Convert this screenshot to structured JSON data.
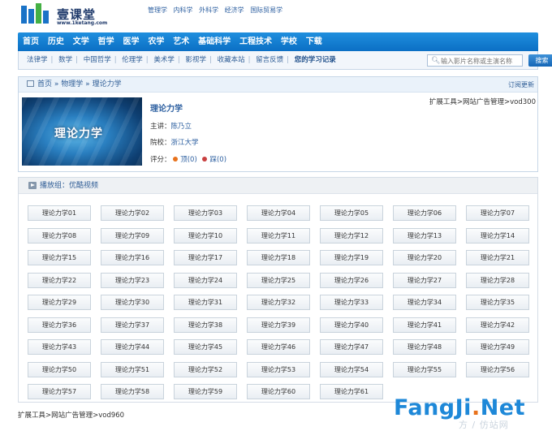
{
  "logo": {
    "name": "壹课堂",
    "url": "www.1ketang.com"
  },
  "toplinks": [
    "管理学",
    "内科学",
    "外科学",
    "经济学",
    "国际贸易学"
  ],
  "nav": [
    "首页",
    "历史",
    "文学",
    "哲学",
    "医学",
    "农学",
    "艺术",
    "基础科学",
    "工程技术",
    "学校",
    "下载"
  ],
  "subnav": [
    "法律学",
    "数学",
    "中国哲学",
    "伦理学",
    "美术学",
    "影视学",
    "收藏本站",
    "留言反馈",
    "您的学习记录"
  ],
  "search": {
    "placeholder": "输入影片名称或主演名称",
    "button": "搜索"
  },
  "breadcrumb": {
    "home": "首页",
    "sep1": "»",
    "category": "物理学",
    "sep2": "»",
    "current": "理论力学",
    "subscribe": "订阅更新"
  },
  "course": {
    "thumb_text": "理论力学",
    "title": "理论力学",
    "lecturer_label": "主讲：",
    "lecturer": "陈乃立",
    "school_label": "院校：",
    "school": "浙江大学",
    "rating_label": "评分：",
    "up": "顶(0)",
    "down": "踩(0)"
  },
  "ad_top": "扩展工具>网站广告管理>vod300",
  "playlist": {
    "label": "播放组：优酷视频",
    "episodes": [
      "理论力学01",
      "理论力学02",
      "理论力学03",
      "理论力学04",
      "理论力学05",
      "理论力学06",
      "理论力学07",
      "理论力学08",
      "理论力学09",
      "理论力学10",
      "理论力学11",
      "理论力学12",
      "理论力学13",
      "理论力学14",
      "理论力学15",
      "理论力学16",
      "理论力学17",
      "理论力学18",
      "理论力学19",
      "理论力学20",
      "理论力学21",
      "理论力学22",
      "理论力学23",
      "理论力学24",
      "理论力学25",
      "理论力学26",
      "理论力学27",
      "理论力学28",
      "理论力学29",
      "理论力学30",
      "理论力学31",
      "理论力学32",
      "理论力学33",
      "理论力学34",
      "理论力学35",
      "理论力学36",
      "理论力学37",
      "理论力学38",
      "理论力学39",
      "理论力学40",
      "理论力学41",
      "理论力学42",
      "理论力学43",
      "理论力学44",
      "理论力学45",
      "理论力学46",
      "理论力学47",
      "理论力学48",
      "理论力学49",
      "理论力学50",
      "理论力学51",
      "理论力学52",
      "理论力学53",
      "理论力学54",
      "理论力学55",
      "理论力学56",
      "理论力学57",
      "理论力学58",
      "理论力学59",
      "理论力学60",
      "理论力学61"
    ]
  },
  "ad_bottom": "扩展工具>网站广告管理>vod960",
  "watermark": {
    "brand_a": "FangJi",
    "dot": ".",
    "brand_b": "Net",
    "sub": "方 / 仿站网"
  },
  "colors": {
    "nav": "#0b6fc4",
    "link": "#2c5fa0",
    "accent": "#e8721c"
  }
}
